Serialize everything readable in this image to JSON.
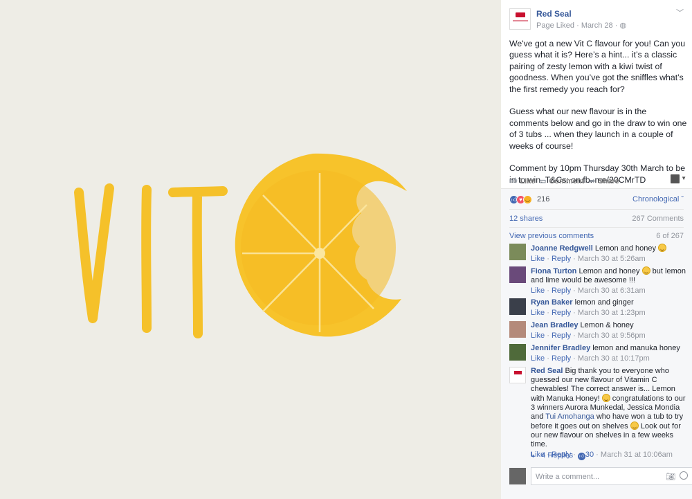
{
  "post": {
    "page_name": "Red Seal",
    "meta": "Page Liked · March 28 · ",
    "paragraphs": [
      "We've got a new Vit C flavour for you! Can you guess what it is? Here’s a hint... it’s a classic pairing of zesty lemon with a kiwi twist of goodness. When you’ve got the sniffles what’s the first remedy you reach for?",
      "Guess what our new flavour is in the comments below and go in the draw to win one of 3 tubs ... when they launch in a couple of weeks of course!",
      "Comment by 10pm Thursday 30th March to be in to win. T&Cs: on.fb. me/20CMrTD"
    ],
    "image_text": "VIT",
    "image_colors": {
      "lemon": "#f7c32b",
      "lemon_dark": "#efb31b",
      "background": "#eeede6"
    }
  },
  "actions": {
    "like": "Like",
    "comment": "Comment",
    "share": "Share"
  },
  "stats": {
    "reaction_count": "216",
    "order": "Chronological",
    "shares": "12 shares",
    "comments": "267 Comments",
    "view_previous": "View previous comments",
    "of_count": "6 of 267"
  },
  "comments": [
    {
      "name": "Joanne Redgwell",
      "text": "Lemon and honey",
      "like": "Like",
      "reply": "Reply",
      "time": "March 30 at 5:26am"
    },
    {
      "name": "Fiona Turton",
      "text": "Lemon and honey",
      "text2": "but lemon and lime would be awesome !!!",
      "like": "Like",
      "reply": "Reply",
      "time": "March 30 at 6:31am"
    },
    {
      "name": "Ryan Baker",
      "text": "lemon and ginger",
      "like": "Like",
      "reply": "Reply",
      "time": "March 30 at 1:23pm"
    },
    {
      "name": "Jean Bradley",
      "text": "Lemon & honey",
      "like": "Like",
      "reply": "Reply",
      "time": "March 30 at 9:56pm"
    },
    {
      "name": "Jennifer Bradley",
      "text": "lemon and manuka honey",
      "like": "Like",
      "reply": "Reply",
      "time": "March 30 at 10:17pm"
    },
    {
      "name": "Red Seal",
      "text": "Big thank you to everyone who guessed our new flavour of Vitamin C chewables! The correct answer is... Lemon with Manuka Honey!",
      "text2": " congratulations to our 3 winners Aurora Munkedal, Jessica Mondia and",
      "mention": "Tui Amohanga",
      "text3": "who have won a tub to try before it goes out on shelves",
      "text4": "Look out for our new flavour on shelves in a few weeks time.",
      "like": "Like",
      "reply": "Reply",
      "likes": "30",
      "time": "March 31 at 10:06am"
    }
  ],
  "replies_link": "4 Replies",
  "write_placeholder": "Write a comment..."
}
